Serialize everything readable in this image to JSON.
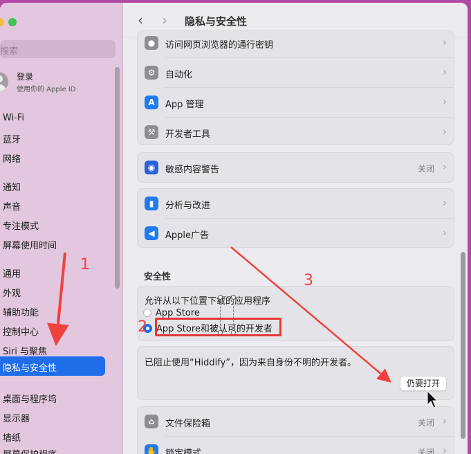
{
  "sidebar": {
    "search_placeholder": "搜索",
    "account_name": "登录",
    "account_sub": "使用你的 Apple ID",
    "items": [
      {
        "label": "Wi-Fi"
      },
      {
        "label": "蓝牙"
      },
      {
        "label": "网络"
      },
      {
        "label": "通知"
      },
      {
        "label": "声音"
      },
      {
        "label": "专注模式"
      },
      {
        "label": "屏幕使用时间"
      },
      {
        "label": "通用"
      },
      {
        "label": "外观"
      },
      {
        "label": "辅助功能"
      },
      {
        "label": "控制中心"
      },
      {
        "label": "Siri 与聚焦"
      },
      {
        "label": "隐私与安全性"
      },
      {
        "label": "桌面与程序坞"
      },
      {
        "label": "显示器"
      },
      {
        "label": "墙纸"
      },
      {
        "label": "屏幕保护程序"
      }
    ]
  },
  "header": {
    "back_icon": "‹",
    "forward_icon": "›",
    "title": "隐私与安全性"
  },
  "rows": {
    "passkeys": "访问网页浏览器的通行密钥",
    "automation": "自动化",
    "app_mgmt": "App 管理",
    "dev_tools": "开发者工具",
    "sensitive": "敏感内容警告",
    "sensitive_value": "关闭",
    "analytics": "分析与改进",
    "apple_ads": "Apple广告",
    "filevault": "文件保险箱",
    "filevault_value": "关闭",
    "lockdown": "锁定模式",
    "lockdown_value": "关闭"
  },
  "security": {
    "section_title": "安全性",
    "allow_label": "允许从以下位置下载的应用程序",
    "option_appstore": "App Store",
    "option_appstore_devs": "App Store和被认可的开发者",
    "blocked_message": "已阻止使用“Hiddify”，因为来自身份不明的开发者。",
    "open_anyway": "仍要打开"
  },
  "annotations": {
    "n1": "1",
    "n2": "2",
    "n3": "3",
    "color": "#f0413e"
  },
  "chevron": "›"
}
